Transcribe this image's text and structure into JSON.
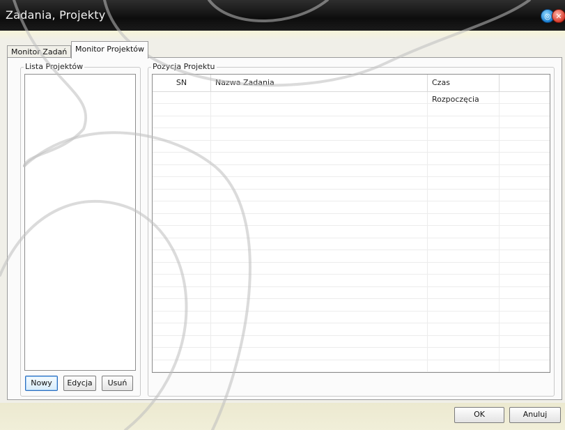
{
  "window": {
    "title": "Zadania, Projekty",
    "help_icon": "help-icon",
    "close_icon": "close-icon"
  },
  "tabs": [
    {
      "label": "Monitor Zadań",
      "active": false
    },
    {
      "label": "Monitor Projektów",
      "active": true
    }
  ],
  "project_list": {
    "group_label": "Lista Projektów",
    "items": [],
    "buttons": {
      "new": "Nowy",
      "edit": "Edycja",
      "delete": "Usuń"
    }
  },
  "project_position": {
    "group_label": "Pozycja Projektu",
    "columns": [
      "SN",
      "Nazwa Zadania",
      "Czas Rozpoczęcia",
      ""
    ],
    "rows": []
  },
  "dialog_buttons": {
    "ok": "OK",
    "cancel": "Anuluj"
  }
}
